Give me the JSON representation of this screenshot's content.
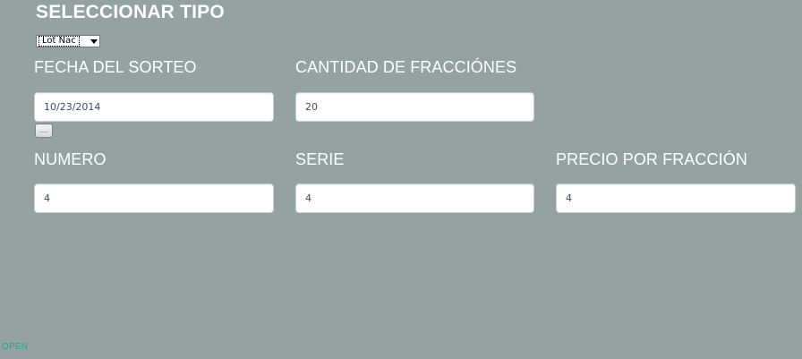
{
  "header": {
    "title": "SELECCIONAR TIPO"
  },
  "type_select": {
    "selected": "Lot Nac"
  },
  "fields": {
    "fecha": {
      "label": "FECHA DEL SORTEO",
      "value": "10/23/2014"
    },
    "cantidad": {
      "label": "CANTIDAD DE FRACCIÓNES",
      "value": "20"
    },
    "numero": {
      "label": "NUMERO",
      "value": "4"
    },
    "serie": {
      "label": "SERIE",
      "value": "4"
    },
    "precio": {
      "label": "PRECIO POR FRACCIÓN",
      "value": "4"
    }
  },
  "footer": {
    "open_label": "OPEN"
  },
  "colors": {
    "background": "#94a3a1",
    "open_link": "#1fa98a",
    "input_text": "#3a4a66"
  }
}
